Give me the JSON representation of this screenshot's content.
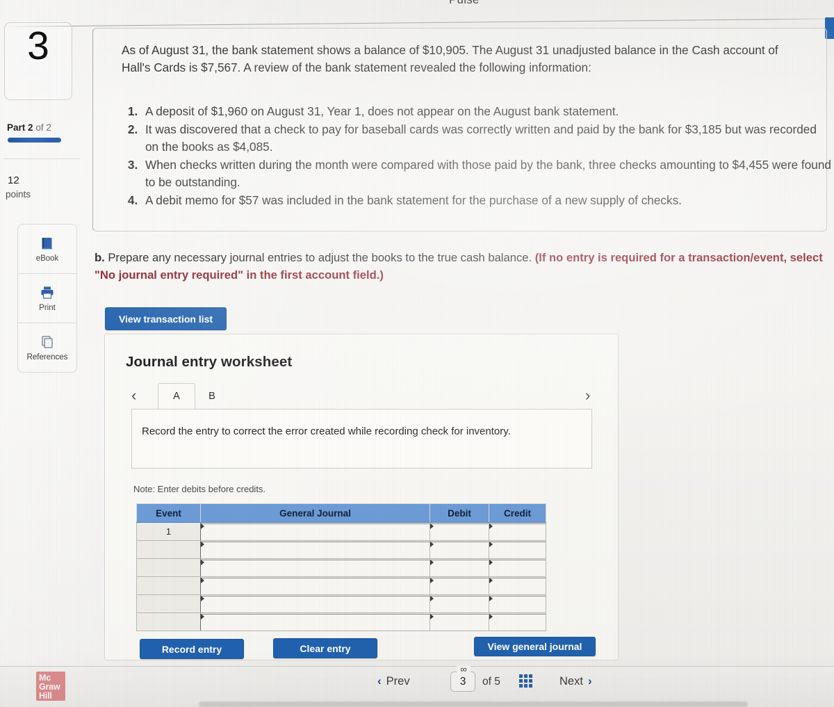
{
  "top": {
    "app_title": "Pulse"
  },
  "rail": {
    "question_number": "3",
    "part_prefix": "Part",
    "part_current": "2",
    "part_joiner": "of",
    "part_total": "2",
    "points_value": "12",
    "points_word": "points",
    "tools": [
      {
        "label": "eBook",
        "icon": "ebook-icon"
      },
      {
        "label": "Print",
        "icon": "printer-icon"
      },
      {
        "label": "References",
        "icon": "references-icon"
      }
    ],
    "logo_lines": [
      "Mc",
      "Graw",
      "Hill"
    ]
  },
  "statement": {
    "intro": "As of August 31, the bank statement shows a balance of $10,905. The August 31 unadjusted balance in the Cash account of Hall's Cards is $7,567. A review of the bank statement revealed the following information:",
    "items": [
      "A deposit of $1,960 on August 31, Year 1, does not appear on the August bank statement.",
      "It was discovered that a check to pay for baseball cards was correctly written and paid by the bank for $3,185 but was recorded on the books as $4,085.",
      "When checks written during the month were compared with those paid by the bank, three checks amounting to $4,455 were found to be outstanding.",
      "A debit memo for $57 was included in the bank statement for the purchase of a new supply of checks."
    ]
  },
  "requirement": {
    "lead": "b.",
    "text": " Prepare any necessary journal entries to adjust the books to the true cash balance. ",
    "hint": "(If no entry is required for a transaction/event, select \"No journal entry required\" in the first account field.)"
  },
  "buttons": {
    "view_transaction_list": "View transaction list",
    "record_entry": "Record entry",
    "clear_entry": "Clear entry",
    "view_general_journal": "View general journal"
  },
  "worksheet": {
    "title": "Journal entry worksheet",
    "tabs": [
      {
        "label": "A",
        "active": true
      },
      {
        "label": "B",
        "active": false
      }
    ],
    "prev_arrow": "‹",
    "next_arrow": "›",
    "prompt": "Record the entry to correct the error created while recording check for inventory.",
    "note": "Note: Enter debits before credits.",
    "table": {
      "headers": [
        "Event",
        "General Journal",
        "Debit",
        "Credit"
      ],
      "rows": [
        {
          "event": "1",
          "general_journal": "",
          "debit": "",
          "credit": ""
        },
        {
          "event": "",
          "general_journal": "",
          "debit": "",
          "credit": ""
        },
        {
          "event": "",
          "general_journal": "",
          "debit": "",
          "credit": ""
        },
        {
          "event": "",
          "general_journal": "",
          "debit": "",
          "credit": ""
        },
        {
          "event": "",
          "general_journal": "",
          "debit": "",
          "credit": ""
        },
        {
          "event": "",
          "general_journal": "",
          "debit": "",
          "credit": ""
        }
      ]
    }
  },
  "bottom_nav": {
    "prev_label": "Prev",
    "prev_chevron": "‹",
    "next_label": "Next",
    "next_chevron": "›",
    "page_current": "3",
    "page_of": "of",
    "page_total": "5",
    "link_glyph": "∞",
    "grid_icon": "grid-icon"
  },
  "colors": {
    "primary_blue": "#2161ad",
    "table_header_blue": "#6c9bd6",
    "hint_red": "#8c1d2a",
    "logo_red": "#c4161c"
  }
}
